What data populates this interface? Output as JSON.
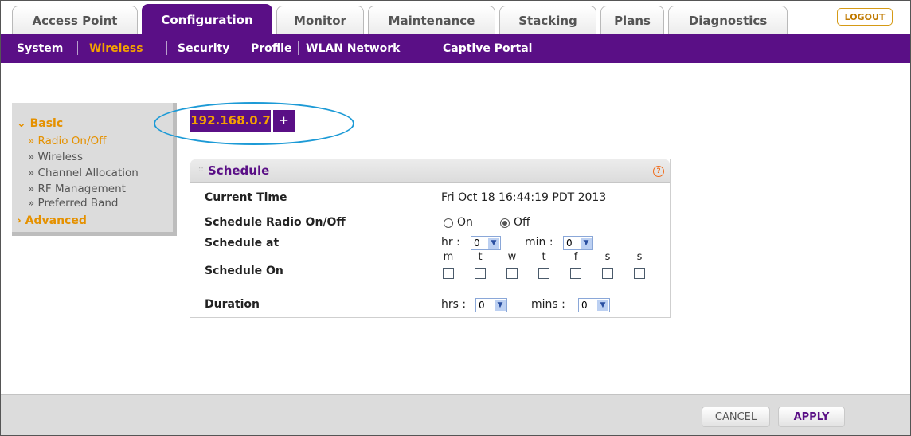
{
  "tabs": [
    {
      "label": "Access Point"
    },
    {
      "label": "Configuration"
    },
    {
      "label": "Monitor"
    },
    {
      "label": "Maintenance"
    },
    {
      "label": "Stacking"
    },
    {
      "label": "Plans"
    },
    {
      "label": "Diagnostics"
    }
  ],
  "logout_label": "LOGOUT",
  "subnav": [
    {
      "label": "System"
    },
    {
      "label": "Wireless"
    },
    {
      "label": "Security"
    },
    {
      "label": "Profile"
    },
    {
      "label": "WLAN Network"
    },
    {
      "label": "Captive Portal"
    }
  ],
  "leftnav": {
    "basic": "Basic",
    "items": [
      {
        "label": "» Radio On/Off"
      },
      {
        "label": "» Wireless"
      },
      {
        "label": "» Channel Allocation"
      },
      {
        "label": "» RF Management"
      },
      {
        "label": "» Preferred Band"
      }
    ],
    "advanced": "Advanced"
  },
  "ap": {
    "ip": "192.168.0.7",
    "add": "+"
  },
  "schedule": {
    "title": "Schedule",
    "help": "?",
    "current_time_label": "Current Time",
    "current_time_value": "Fri Oct 18 16:44:19 PDT 2013",
    "radio_label": "Schedule Radio On/Off",
    "radio_on": "On",
    "radio_off": "Off",
    "radio_selected": "Off",
    "at_label": "Schedule at",
    "hr_label": "hr :",
    "hr_value": "0",
    "min_label": "min :",
    "min_value": "0",
    "on_label": "Schedule On",
    "days": [
      "m",
      "t",
      "w",
      "t",
      "f",
      "s",
      "s"
    ],
    "duration_label": "Duration",
    "hrs_label": "hrs :",
    "hrs_value": "0",
    "mins_label": "mins :",
    "mins_value": "0"
  },
  "buttons": {
    "cancel": "CANCEL",
    "apply": "APPLY"
  },
  "colors": {
    "brand_purple": "#5a0f86",
    "accent_orange": "#f4a100",
    "highlight_blue": "#1c9ad6"
  }
}
